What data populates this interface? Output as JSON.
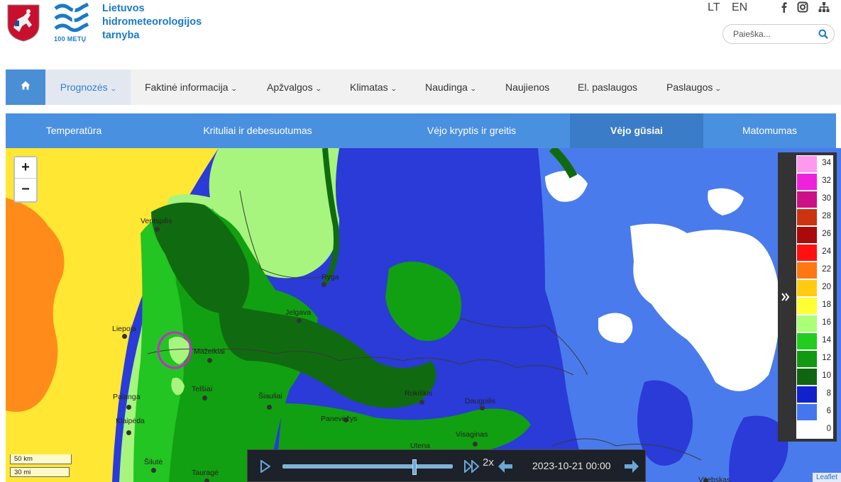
{
  "header": {
    "org_name_lines": [
      "Lietuvos",
      "hidrometeorologijos",
      "tarnyba"
    ],
    "logo_caption": "100 METŲ",
    "languages": [
      "LT",
      "EN"
    ],
    "social_icons": [
      "facebook-icon",
      "instagram-icon",
      "sitemap-icon"
    ],
    "search_placeholder": "Paieška..."
  },
  "main_nav": {
    "home_icon": "home-icon",
    "items": [
      {
        "label": "Prognozės",
        "dropdown": true,
        "active": true
      },
      {
        "label": "Faktinė informacija",
        "dropdown": true
      },
      {
        "label": "Apžvalgos",
        "dropdown": true
      },
      {
        "label": "Klimatas",
        "dropdown": true
      },
      {
        "label": "Naudinga",
        "dropdown": true
      },
      {
        "label": "Naujienos",
        "dropdown": false
      },
      {
        "label": "El. paslaugos",
        "dropdown": false
      },
      {
        "label": "Paslaugos",
        "dropdown": true
      }
    ]
  },
  "sub_nav": {
    "items": [
      {
        "label": "Temperatūra"
      },
      {
        "label": "Krituliai ir debesuotumas"
      },
      {
        "label": "Vėjo kryptis ir greitis"
      },
      {
        "label": "Vėjo gūsiai",
        "active": true
      },
      {
        "label": "Matomumas"
      }
    ]
  },
  "map": {
    "zoom_in": "+",
    "zoom_out": "−",
    "cities": [
      "Ventspilis",
      "Ryga",
      "Jelgava",
      "Liepoja",
      "Mažeikiai",
      "Telšiai",
      "Šiauliai",
      "Palanga",
      "Klaipėda",
      "Panevėžys",
      "Rokiškis",
      "Daugpilis",
      "Visaginas",
      "Utena",
      "Šilutė",
      "Tauragė",
      "Vitebskas"
    ],
    "legend": {
      "values": [
        34,
        32,
        30,
        28,
        26,
        24,
        22,
        20,
        18,
        16,
        14,
        12,
        10,
        8,
        6,
        0
      ],
      "colors": [
        "#ff99ee",
        "#ee22dd",
        "#cc1188",
        "#cc3311",
        "#aa0a0a",
        "#ff1111",
        "#ff7711",
        "#ffcc11",
        "#ffff33",
        "#aaff77",
        "#22cc22",
        "#119911",
        "#106610",
        "#1122cc",
        "#4477ee",
        "#ffffff"
      ],
      "toggle_icon": "double-chevron-right-icon"
    },
    "scale": {
      "km": "50 km",
      "mi": "30 mi"
    },
    "player": {
      "speed": "2x",
      "timestamp": "2023-10-21 00:00",
      "progress": 0.77
    },
    "attribution": "Leaflet"
  }
}
